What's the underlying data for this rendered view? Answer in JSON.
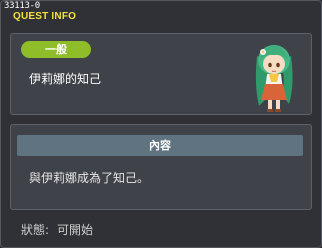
{
  "quest": {
    "id": "33113-0",
    "window_title": "QUEST INFO",
    "category": "一般",
    "name": "伊莉娜的知己"
  },
  "content": {
    "header": "內容",
    "text": "與伊莉娜成為了知己。"
  },
  "status": {
    "label": "狀態:",
    "value": "可開始"
  },
  "colors": {
    "title": "#f4e23a",
    "badge": "#8fbd2a",
    "content_header": "#5f7380",
    "npc_hair": "#3fae7a"
  }
}
